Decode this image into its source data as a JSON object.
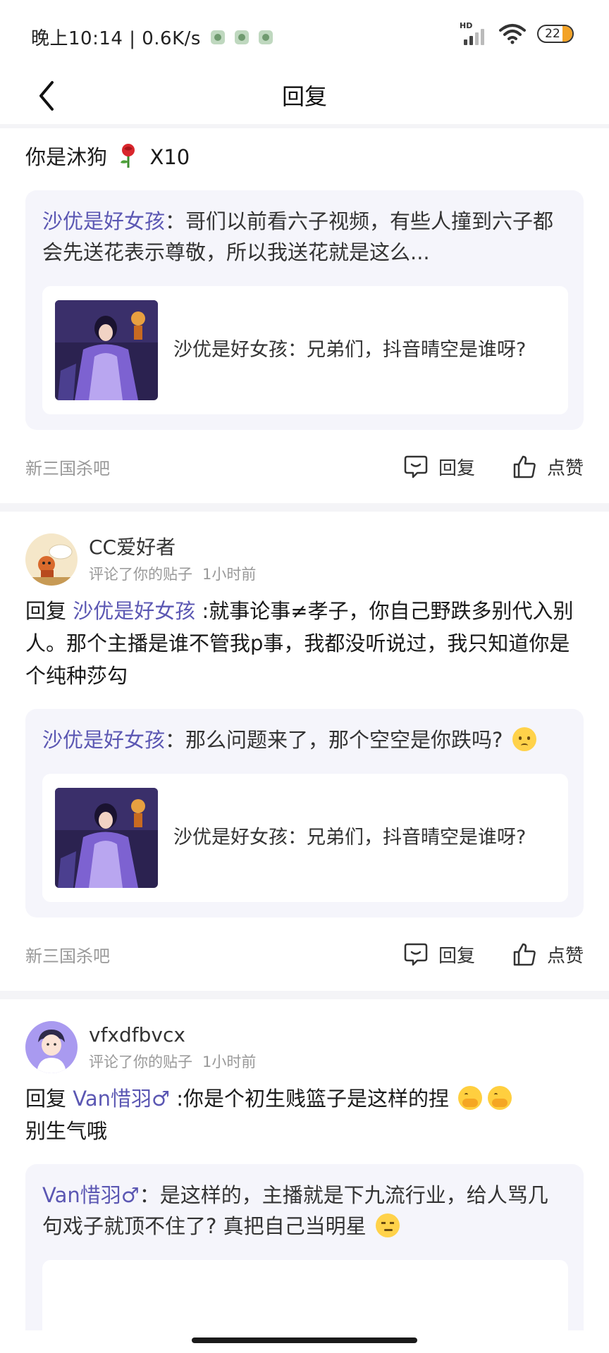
{
  "status_bar": {
    "time_speed": "晚上10:14 | 0.6K/s",
    "signal_label": "HD",
    "battery": "22",
    "battery_level": 0.22
  },
  "nav": {
    "title": "回复",
    "back_icon": "chevron-left-icon"
  },
  "first_card": {
    "comment_text": "你是沐狗",
    "rose_count": "X10",
    "quote_author": "沙优是好女孩",
    "quote_sep": "：",
    "quote_body": "哥们以前看六子视频，有些人撞到六子都会先送花表示尊敬，所以我送花就是这么...",
    "post_text": "沙优是好女孩：兄弟们，抖音晴空是谁呀?",
    "forum": "新三国杀吧",
    "reply_label": "回复",
    "like_label": "点赞"
  },
  "second_card": {
    "username": "CC爱好者",
    "meta_action": "评论了你的贴子",
    "meta_time": "1小时前",
    "reply_prefix": "回复",
    "mention": "沙优是好女孩",
    "comment_body": ":就事论事≠孝子，你自己野跌多别代入别人。那个主播是谁不管我p事，我都没听说过，我只知道你是个纯种莎勾",
    "quote_author": "沙优是好女孩",
    "quote_sep": "：",
    "quote_body": "那么问题来了，那个空空是你跌吗?",
    "post_text": "沙优是好女孩：兄弟们，抖音晴空是谁呀?",
    "forum": "新三国杀吧",
    "reply_label": "回复",
    "like_label": "点赞"
  },
  "third_card": {
    "username": "vfxdfbvcx",
    "meta_action": "评论了你的贴子",
    "meta_time": "1小时前",
    "reply_prefix": "回复",
    "mention": "Van惜羽♂",
    "comment_body": ":你是个初生贱篮子是这样的捏",
    "comment_tail": "别生气哦",
    "quote_author": "Van惜羽♂",
    "quote_sep": "：",
    "quote_body": "是这样的，主播就是下九流行业，给人骂几句戏子就顶不住了? 真把自己当明星"
  },
  "colors": {
    "accent": "#5b57b3",
    "quote_bg": "#f5f5fb",
    "divider": "#f4f4f7",
    "meta": "#999999"
  }
}
